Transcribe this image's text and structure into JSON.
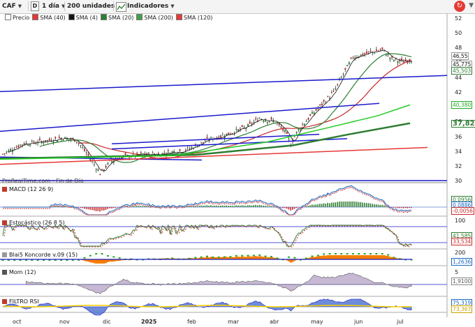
{
  "toolbar": {
    "symbol": "CAF",
    "d_label": "D",
    "period": "1 día",
    "units": "200 unidades",
    "indicators": "Indicadores"
  },
  "legend": {
    "items": [
      {
        "label": "Precio",
        "color": "#ffffff"
      },
      {
        "label": "SMA (40)",
        "color": "#e53935"
      },
      {
        "label": "SMA (4)",
        "color": "#111111"
      },
      {
        "label": "SMA (20)",
        "color": "#2e7d32"
      },
      {
        "label": "SMA (200)",
        "color": "#43a047"
      },
      {
        "label": "SMA (120)",
        "color": "#e53935"
      }
    ]
  },
  "price_axis": [
    "52",
    "50",
    "48",
    "46",
    "44",
    "42",
    "40",
    "38",
    "36",
    "34",
    "32",
    "30"
  ],
  "price_tags": {
    "t1": "46,55",
    "t2": "45,775",
    "t3": "45,503",
    "t4": "40,380",
    "t5": "37,828"
  },
  "watermark": "ProRealTime.com - Fin de Día",
  "panes": {
    "macd": {
      "title": "MACD (12 26 9)",
      "v1": "0,0956",
      "v2": "0,0886",
      "v3": "-0,0056"
    },
    "stoch": {
      "title": "Estocástico (26 8 5)",
      "axis_top": "100",
      "v1": "41,585",
      "v2": "33,534"
    },
    "konc": {
      "title": "Blai5 Koncorde v.09 (15)",
      "axis_top": "200",
      "v1": "1,2636"
    },
    "mom": {
      "title": "Mom (12)",
      "axis_top": "5",
      "v1": "1,9100"
    },
    "rsi": {
      "title": "FILTRO RSI",
      "v1": "75,319",
      "v2": "73,367"
    }
  },
  "x_labels": [
    "oct",
    "nov",
    "dic",
    "2025",
    "feb",
    "mar",
    "abr",
    "may",
    "jun",
    "jul"
  ],
  "colors": {
    "up": "#2e7d32",
    "down": "#c62828",
    "blue": "#1a1acc",
    "green": "#2e7d32",
    "lime": "#22cc22",
    "red": "#e53935"
  }
}
